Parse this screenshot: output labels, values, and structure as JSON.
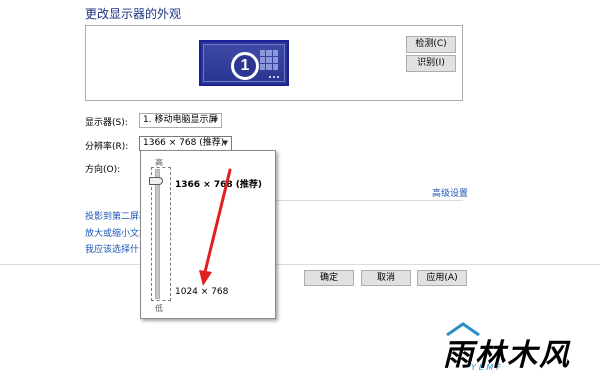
{
  "page_title": "更改显示器的外观",
  "preview": {
    "monitor_number": "1",
    "detect_label": "检测(C)",
    "identify_label": "识别(I)"
  },
  "settings": {
    "display_label": "显示器(S):",
    "display_value": "1. 移动电脑显示屏",
    "resolution_label": "分辨率(R):",
    "resolution_value": "1366 × 768 (推荐)",
    "orientation_label": "方向(O):"
  },
  "advanced_link": "高级设置",
  "links": [
    "投影到第二屏幕",
    "放大或缩小文本",
    "我应该选择什么"
  ],
  "footer": {
    "ok": "确定",
    "cancel": "取消",
    "apply": "应用(A)"
  },
  "resolution_popup": {
    "high_label": "高",
    "low_label": "低",
    "top_option": "1366 × 768 (推荐)",
    "bottom_option": "1024 × 768",
    "slider_level": 1.0
  },
  "watermark": {
    "text": "雨林木风",
    "sub": "YLMF"
  },
  "colors": {
    "title": "#1e3287",
    "link": "#1f56b5",
    "monitor": "#2a3590",
    "arrow": "#e02020"
  }
}
